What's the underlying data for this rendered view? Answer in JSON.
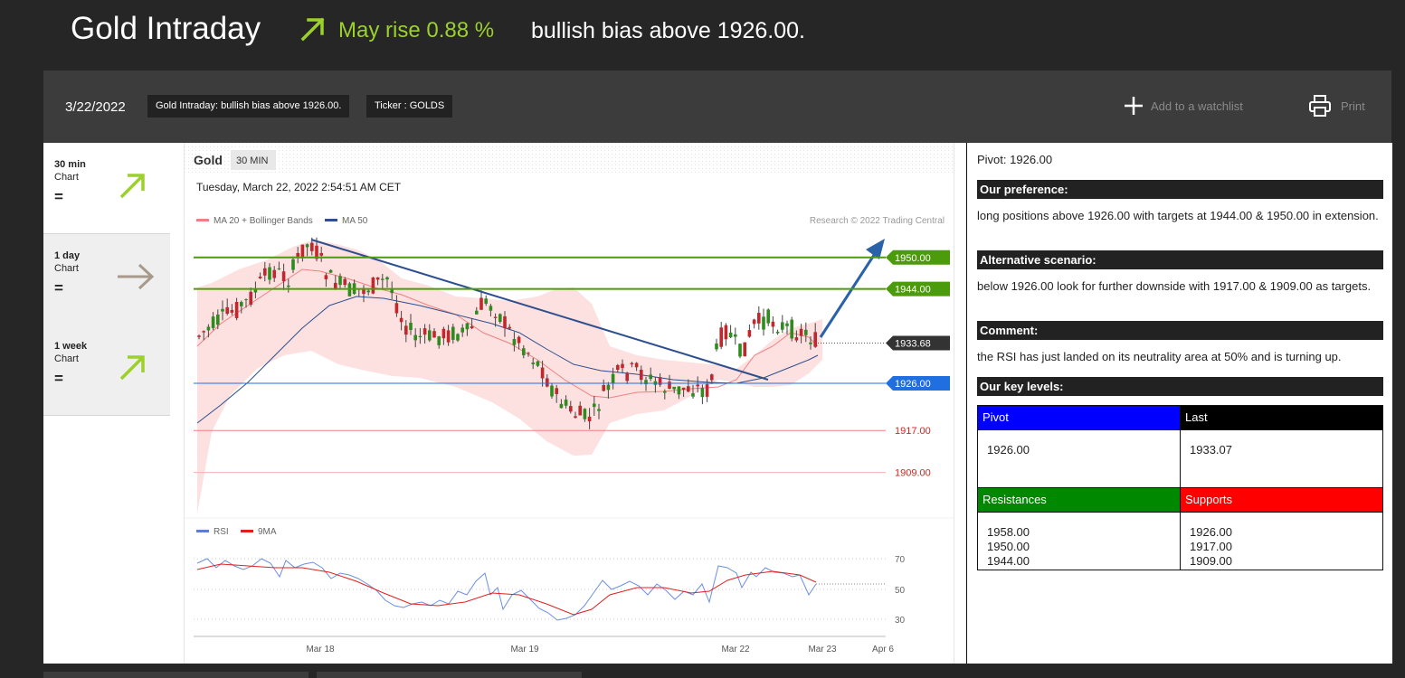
{
  "header": {
    "title": "Gold Intraday",
    "rise_text": "May rise 0.88 %",
    "bias_text": "bullish bias above 1926.00.",
    "accent": "#9bd12a"
  },
  "toolbar": {
    "date": "3/22/2022",
    "summary_pill": "Gold Intraday: bullish bias above 1926.00.",
    "ticker_pill": "Ticker : GOLDS",
    "watchlist": "Add to a watchlist",
    "print": "Print"
  },
  "timeframes": [
    {
      "title": "30 min",
      "sub": "Chart",
      "sign": "=",
      "icon": "arrow-up-right-icon",
      "color": "#9bd12a"
    },
    {
      "title": "1 day",
      "sub": "Chart",
      "sign": "=",
      "icon": "arrow-right-icon",
      "color": "#a89a8a"
    },
    {
      "title": "1 week",
      "sub": "Chart",
      "sign": "=",
      "icon": "arrow-up-right-icon",
      "color": "#9bd12a"
    }
  ],
  "chart": {
    "instrument": "Gold",
    "interval": "30 MIN",
    "timestamp": "Tuesday, March 22, 2022 2:54:51 AM CET",
    "legend_ma20": "MA 20 + Bollinger Bands",
    "legend_ma50": "MA 50",
    "credit": "Research © 2022 Trading Central",
    "rsi_legend": "RSI",
    "rsi_ma_legend": "9MA",
    "x_labels": [
      "Mar 18",
      "Mar 19",
      "Mar 22",
      "Mar 23",
      "Apr 6"
    ],
    "rsi_levels": [
      "70",
      "50",
      "30"
    ],
    "levels": [
      {
        "label": "1950.00",
        "value": 1950.0,
        "color": "#4c9b0c",
        "style": "badge"
      },
      {
        "label": "1944.00",
        "value": 1944.0,
        "color": "#4c9b0c",
        "style": "badge"
      },
      {
        "label": "1933.68",
        "value": 1933.68,
        "color": "#333333",
        "style": "badge"
      },
      {
        "label": "1926.00",
        "value": 1926.0,
        "color": "#1f6fe0",
        "style": "badge"
      },
      {
        "label": "1917.00",
        "value": 1917.0,
        "color": "#e02020",
        "style": "text"
      },
      {
        "label": "1909.00",
        "value": 1909.0,
        "color": "#e02020",
        "style": "text"
      }
    ]
  },
  "analysis": {
    "pivot_line": "Pivot: 1926.00",
    "pref_title": "Our preference:",
    "pref_text": "long positions above 1926.00 with targets at 1944.00 & 1950.00 in extension.",
    "alt_title": "Alternative scenario:",
    "alt_text": "below 1926.00 look for further downside with 1917.00 & 1909.00 as targets.",
    "comment_title": "Comment:",
    "comment_text": "the RSI has just landed on its neutrality area at 50% and is turning up.",
    "levels_title": "Our key levels:",
    "table": {
      "pivot_h": "Pivot",
      "pivot_v": "1926.00",
      "last_h": "Last",
      "last_v": "1933.07",
      "res_h": "Resistances",
      "res_v": [
        "1958.00",
        "1950.00",
        "1944.00"
      ],
      "sup_h": "Supports",
      "sup_v": [
        "1926.00",
        "1917.00",
        "1909.00"
      ]
    },
    "colors": {
      "pivot": "#0000ff",
      "last": "#000000",
      "resistances": "#008800",
      "supports": "#ff0000"
    }
  }
}
